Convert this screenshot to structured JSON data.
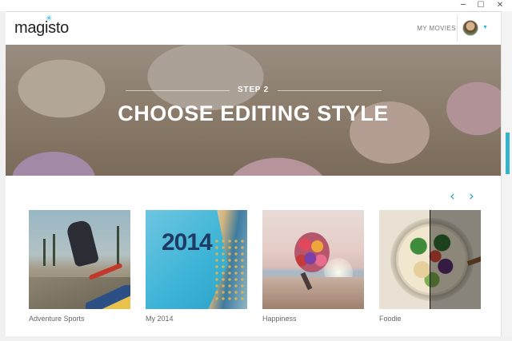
{
  "window": {
    "controls": [
      "─",
      "☐",
      "✕"
    ]
  },
  "header": {
    "logo": "magisto",
    "nav_link": "MY MOVIES",
    "accent_color": "#2bb3d8"
  },
  "hero": {
    "step": "STEP 2",
    "title": "CHOOSE EDITING STYLE"
  },
  "carousel": {
    "prev": "‹",
    "next": "›",
    "arrow_color": "#2a9fc4",
    "styles": [
      {
        "label": "Adventure Sports",
        "image": "skateboarder-photo"
      },
      {
        "label": "My 2014",
        "image": "2014-page-curl-photo"
      },
      {
        "label": "Happiness",
        "image": "balloons-beach-photo"
      },
      {
        "label": "Foodie",
        "image": "salad-bowl-photo"
      }
    ]
  },
  "scrollbar": {
    "thumb_color": "#34b3c9"
  }
}
